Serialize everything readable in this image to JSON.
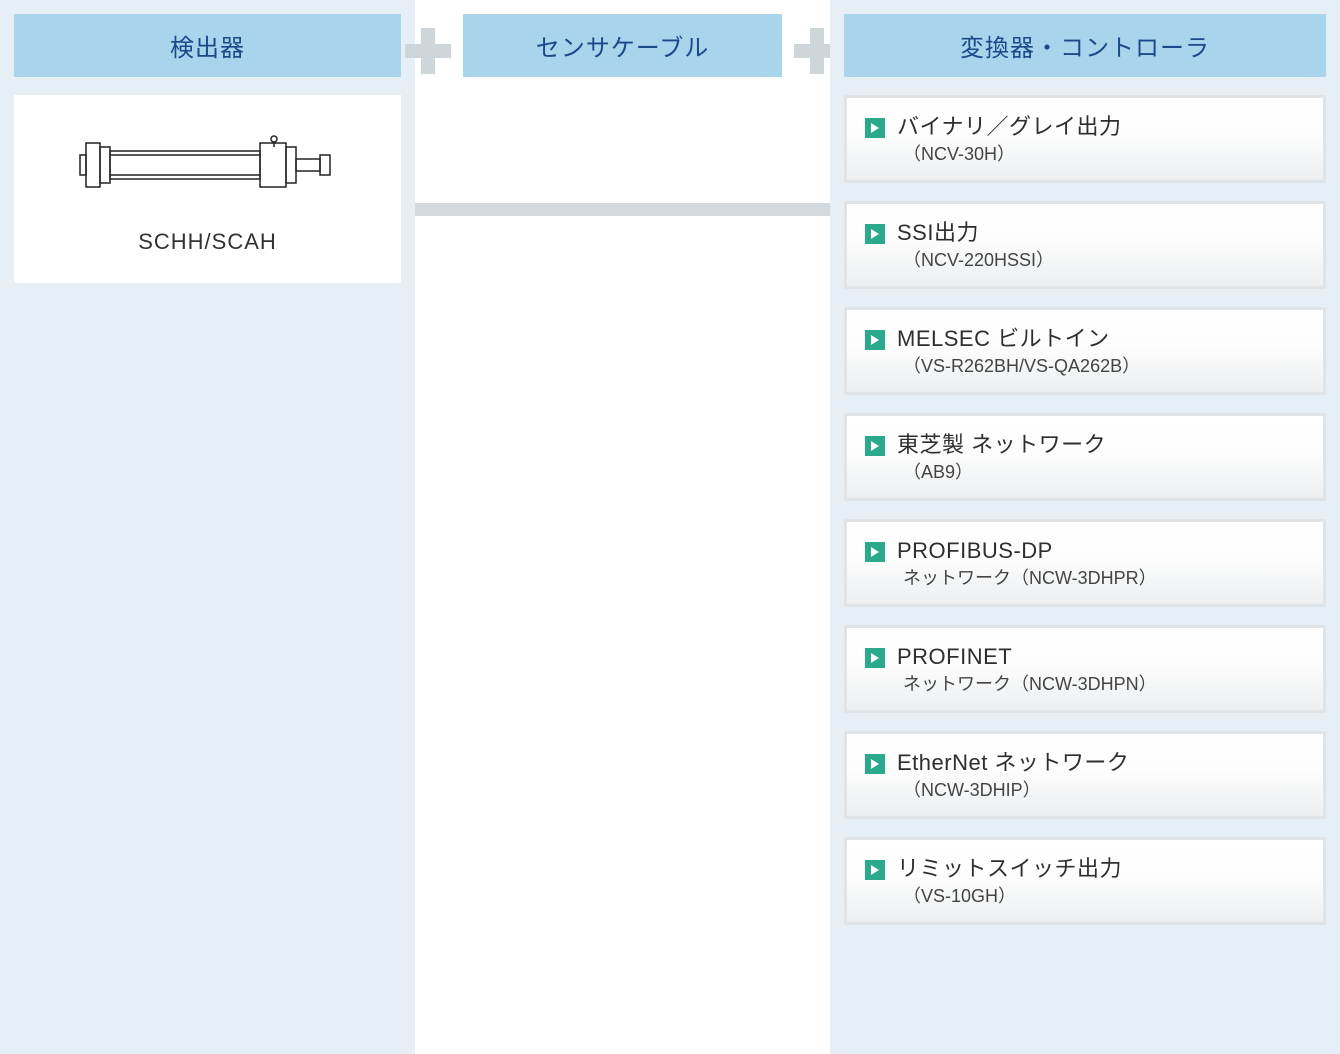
{
  "columns": {
    "detector_header": "検出器",
    "cable_header": "センサケーブル",
    "converter_header": "変換器・コントローラ"
  },
  "detector": {
    "product_label": "SCHH/SCAH"
  },
  "controllers": [
    {
      "title": "バイナリ／グレイ出力",
      "sub": "（NCV-30H）"
    },
    {
      "title": "SSI出力",
      "sub": "（NCV-220HSSI）"
    },
    {
      "title": "MELSEC ビルトイン",
      "sub": "（VS-R262BH/VS-QA262B）"
    },
    {
      "title": "東芝製 ネットワーク",
      "sub": "（AB9）"
    },
    {
      "title": "PROFIBUS-DP",
      "sub": "ネットワーク（NCW-3DHPR）"
    },
    {
      "title": "PROFINET",
      "sub": "ネットワーク（NCW-3DHPN）"
    },
    {
      "title": "EtherNet ネットワーク",
      "sub": "（NCW-3DHIP）"
    },
    {
      "title": "リミットスイッチ出力",
      "sub": "（VS-10GH）"
    }
  ]
}
